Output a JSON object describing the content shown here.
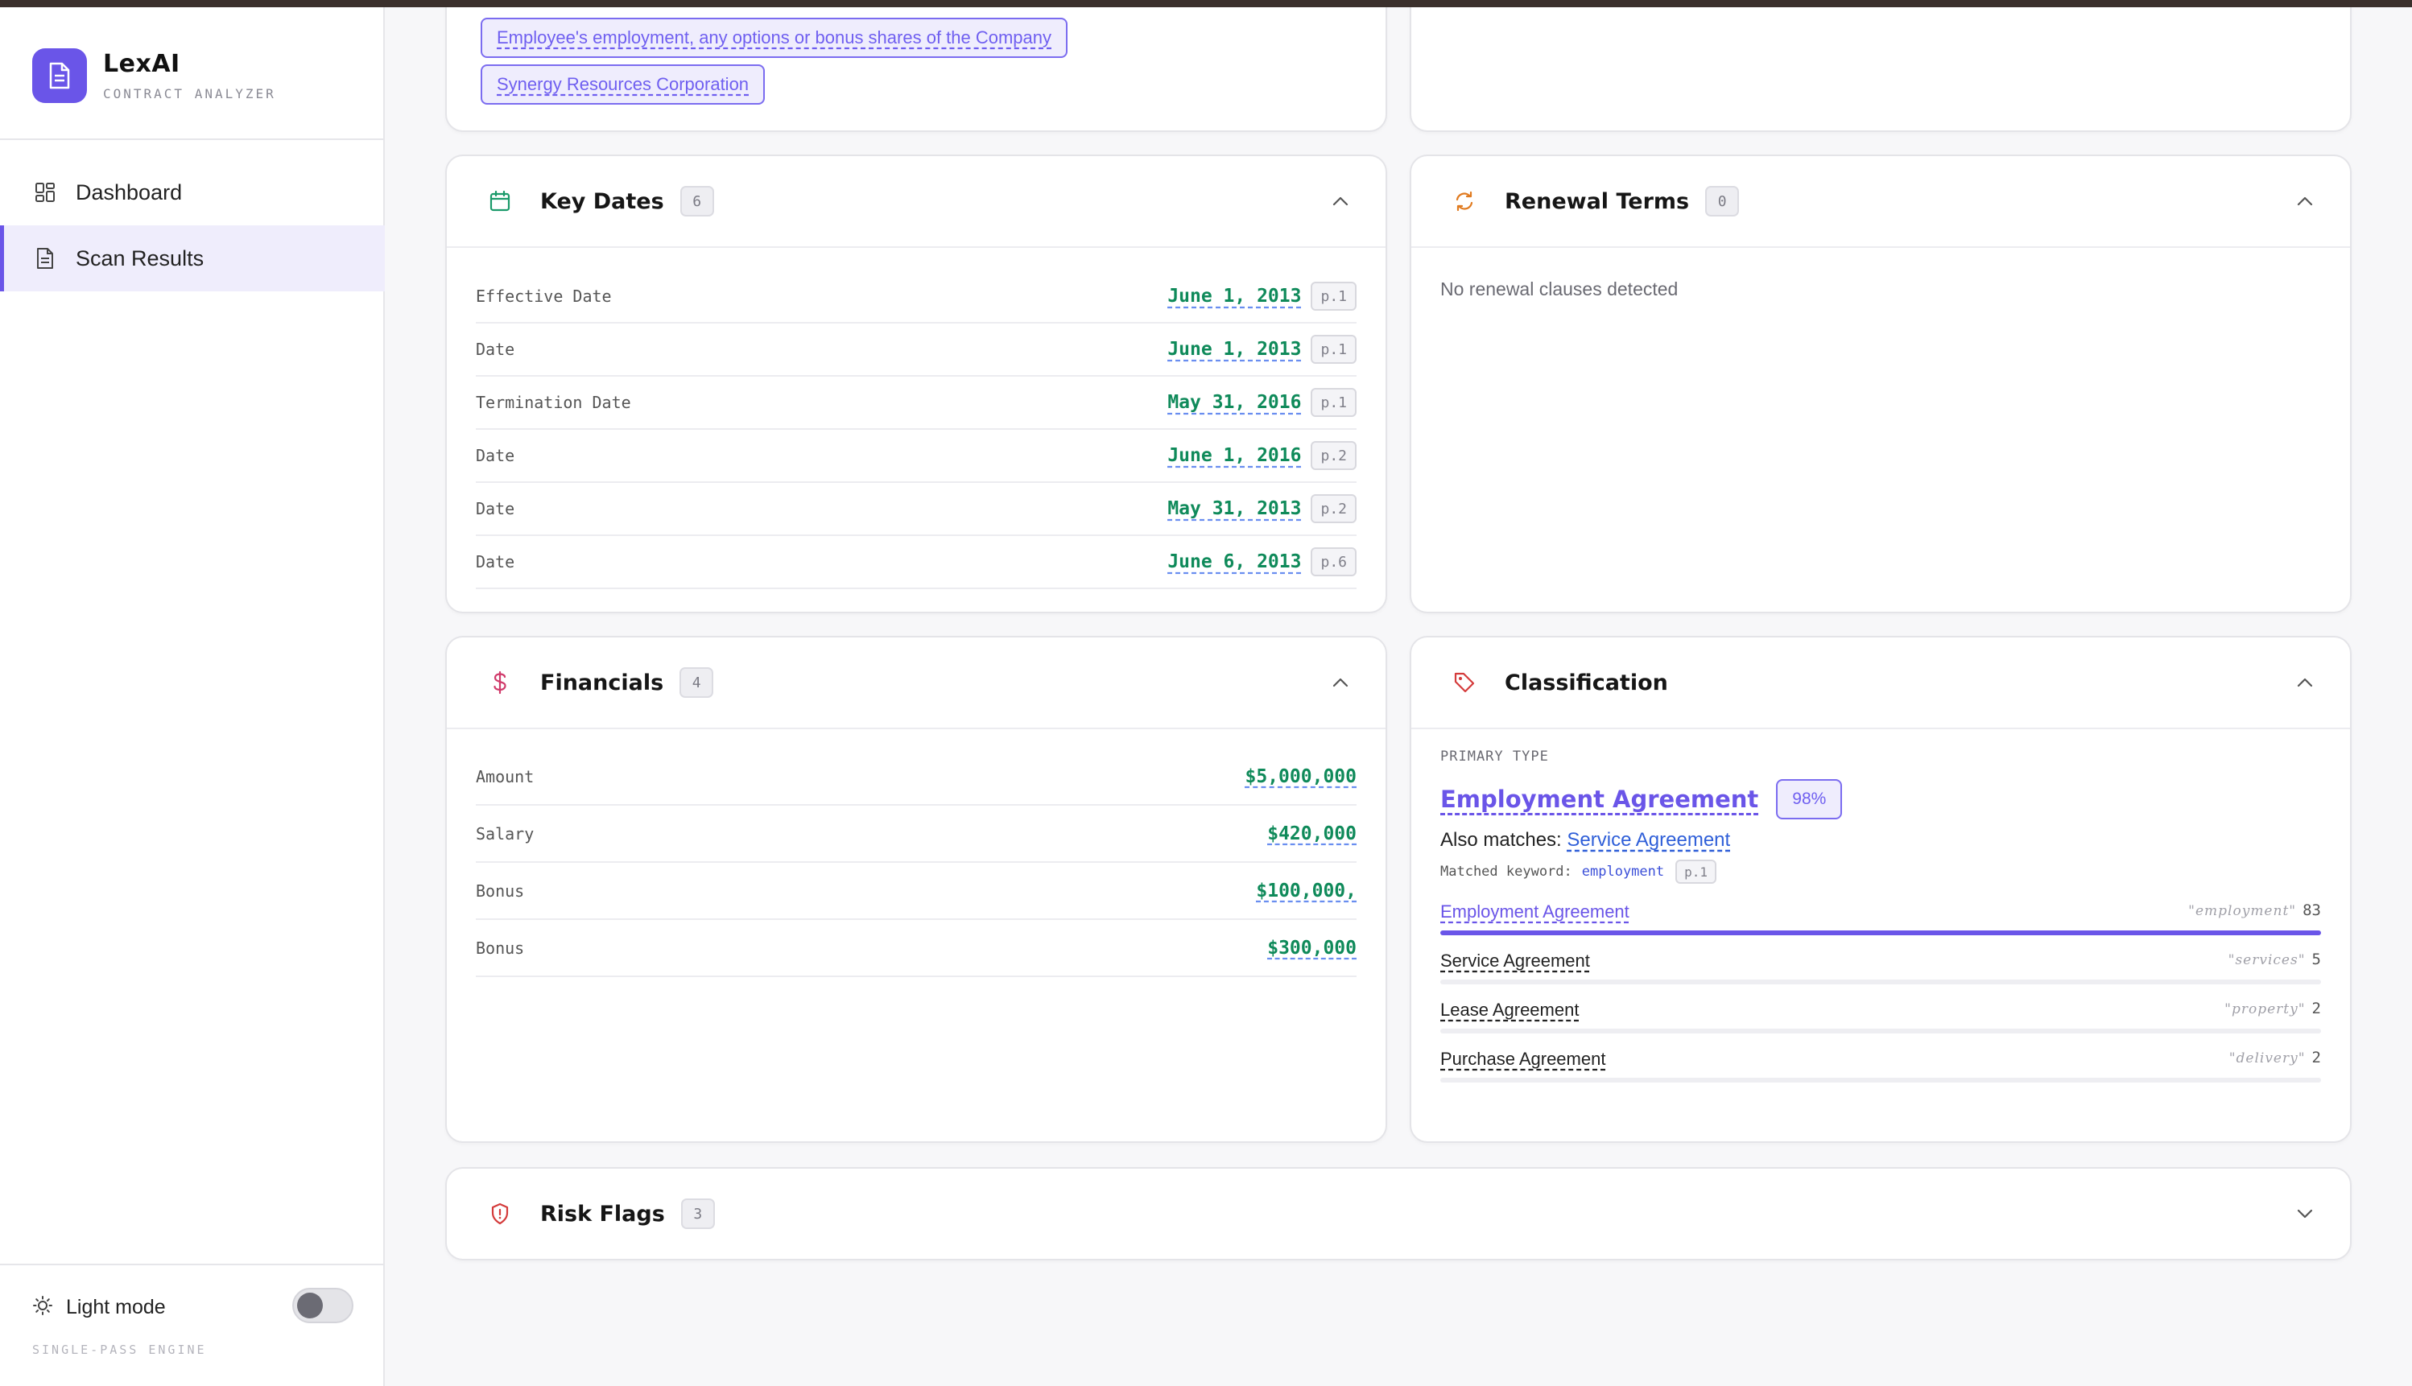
{
  "app": {
    "name": "LexAI",
    "subtitle": "CONTRACT ANALYZER",
    "accent": "#6a55e8"
  },
  "sidebar": {
    "items": [
      {
        "label": "Dashboard",
        "icon": "grid-icon"
      },
      {
        "label": "Scan Results",
        "icon": "document-icon",
        "active": true
      }
    ],
    "mode_label": "Light mode",
    "mode_toggle_on": false,
    "engine_label": "SINGLE-PASS ENGINE"
  },
  "parties": {
    "chips": [
      "Employee's employment, any options or bonus shares of the Company",
      "Synergy Resources Corporation"
    ]
  },
  "key_dates": {
    "title": "Key Dates",
    "count": "6",
    "rows": [
      {
        "label": "Effective Date",
        "value": "June 1, 2013",
        "page": "p.1"
      },
      {
        "label": "Date",
        "value": "June 1, 2013",
        "page": "p.1"
      },
      {
        "label": "Termination Date",
        "value": "May 31, 2016",
        "page": "p.1"
      },
      {
        "label": "Date",
        "value": "June 1, 2016",
        "page": "p.2"
      },
      {
        "label": "Date",
        "value": "May 31, 2013",
        "page": "p.2"
      },
      {
        "label": "Date",
        "value": "June 6, 2013",
        "page": "p.6"
      }
    ]
  },
  "renewal_terms": {
    "title": "Renewal Terms",
    "count": "0",
    "empty_text": "No renewal clauses detected"
  },
  "financials": {
    "title": "Financials",
    "count": "4",
    "rows": [
      {
        "label": "Amount",
        "value": "$5,000,000"
      },
      {
        "label": "Salary",
        "value": "$420,000"
      },
      {
        "label": "Bonus",
        "value": "$100,000,"
      },
      {
        "label": "Bonus",
        "value": "$300,000"
      }
    ]
  },
  "classification": {
    "title": "Classification",
    "primary_label": "PRIMARY TYPE",
    "primary_type": "Employment Agreement",
    "confidence": "98%",
    "also_prefix": "Also matches:",
    "also_match": "Service Agreement",
    "keyword_prefix": "Matched keyword:",
    "keyword": "employment",
    "keyword_page": "p.1",
    "scores": [
      {
        "name": "Employment Agreement",
        "keyword": "\"employment\"",
        "score": "83",
        "fraction": 1.0
      },
      {
        "name": "Service Agreement",
        "keyword": "\"services\"",
        "score": "5",
        "fraction": 0.0
      },
      {
        "name": "Lease Agreement",
        "keyword": "\"property\"",
        "score": "2",
        "fraction": 0.0
      },
      {
        "name": "Purchase Agreement",
        "keyword": "\"delivery\"",
        "score": "2",
        "fraction": 0.0
      }
    ]
  },
  "risk_flags": {
    "title": "Risk Flags",
    "count": "3"
  },
  "colors": {
    "date_green": "#0f8a5a",
    "financial_icon": "#d03a6a",
    "renewal_icon": "#e07a1f",
    "risk_icon": "#d43b3b",
    "key_dates_icon": "#1a9a6a"
  }
}
